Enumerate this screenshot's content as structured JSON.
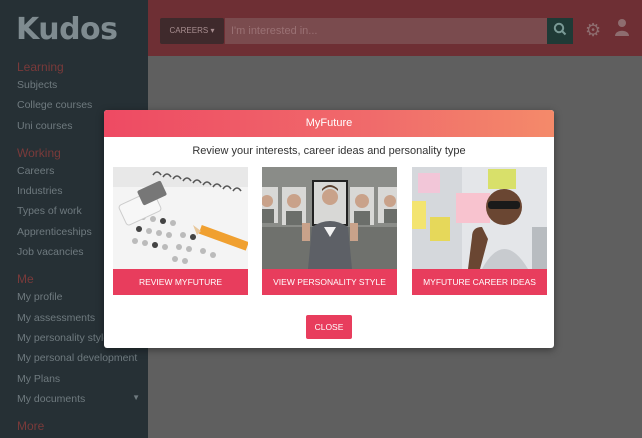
{
  "brand": {
    "logo": "Kudos"
  },
  "sidebar": {
    "sections": [
      {
        "title": "Learning",
        "items": [
          "Subjects",
          "College courses",
          "Uni courses"
        ]
      },
      {
        "title": "Working",
        "items": [
          "Careers",
          "Industries",
          "Types of work",
          "Apprenticeships",
          "Job vacancies"
        ]
      },
      {
        "title": "Me",
        "items": [
          "My profile",
          "My assessments",
          "My personality style",
          "My personal development",
          "My Plans",
          "My documents"
        ]
      },
      {
        "title": "More",
        "items": []
      }
    ]
  },
  "header": {
    "category_label": "CAREERS",
    "search_placeholder": "I'm interested in...",
    "search_icon": "search-icon",
    "settings_icon": "gear-icon",
    "user_icon": "user-icon"
  },
  "modal": {
    "title": "MyFuture",
    "subtitle": "Review your interests, career ideas and personality type",
    "cards": [
      {
        "label": "REVIEW MYFUTURE"
      },
      {
        "label": "VIEW PERSONALITY STYLE"
      },
      {
        "label": "MYFUTURE CAREER IDEAS"
      }
    ],
    "close_label": "CLOSE"
  },
  "colors": {
    "accent": "#e83d5d",
    "sidebar": "#263035",
    "header": "#6e2f34"
  }
}
